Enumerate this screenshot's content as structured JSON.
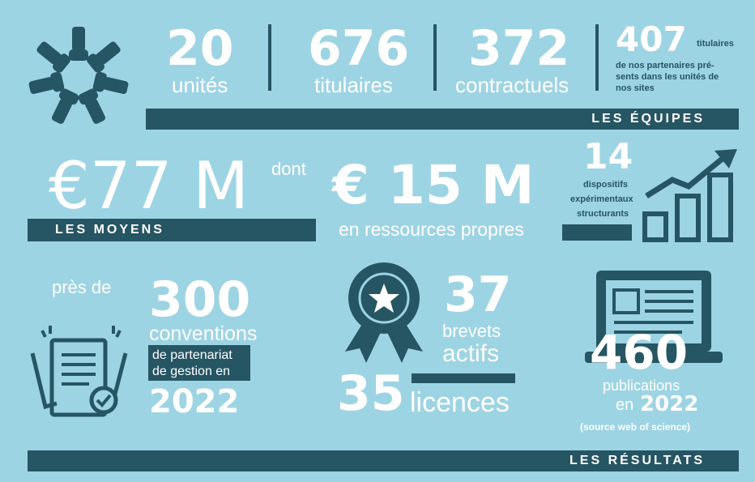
{
  "equipes": {
    "units_value": "20",
    "units_label": "unités",
    "titulaires_value": "676",
    "titulaires_label": "titulaires",
    "contractuels_value": "372",
    "contractuels_label": "contractuels",
    "partners_value": "407",
    "partners_text_1": "titulaires",
    "partners_text_2": "de nos partenaires pré-",
    "partners_text_3": "sents dans les unités de",
    "partners_text_4": "nos sites",
    "section_label": "LES ÉQUIPES"
  },
  "moyens": {
    "total_value": "€77 M",
    "connector": "dont",
    "own_value": "€ 15 M",
    "own_label": "en ressources propres",
    "section_label": "LES MOYENS",
    "devices_value": "14",
    "devices_text_1": "dispositifs",
    "devices_text_2": "expérimentaux",
    "devices_text_3": "structurants"
  },
  "resultats": {
    "near_label": "près de",
    "conventions_value": "300",
    "conventions_label": "conventions",
    "conventions_text_1": "de partenariat",
    "conventions_text_2": "de gestion en",
    "conventions_year": "2022",
    "patents_value": "37",
    "patents_label_1": "brevets",
    "patents_label_2": "actifs",
    "licenses_value": "35",
    "licenses_label": "licences",
    "publications_value": "460",
    "publications_label": "publications",
    "publications_in": "en",
    "publications_year": "2022",
    "publications_source": "(source web of science)",
    "section_label": "LES RÉSULTATS"
  },
  "icons": [
    "hands-circle-icon",
    "growth-chart-icon",
    "document-check-icon",
    "award-ribbon-icon",
    "laptop-icon"
  ],
  "colors": {
    "background": "#9dd4e4",
    "dark": "#265563",
    "text": "#ffffff"
  }
}
